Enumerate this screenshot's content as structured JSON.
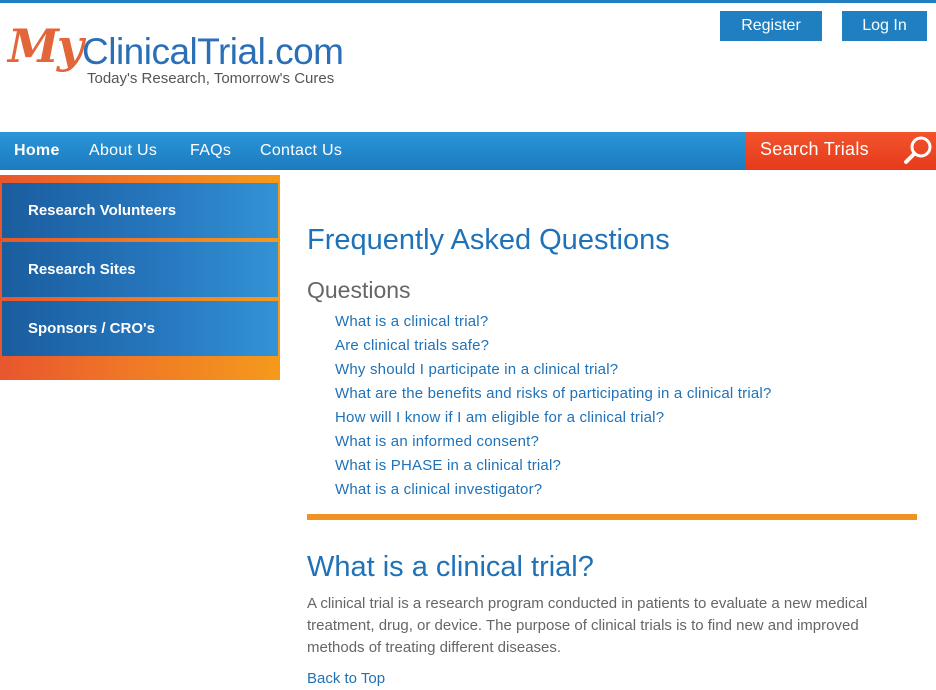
{
  "logo": {
    "my": "My",
    "name": "ClinicalTrial.com",
    "tagline": "Today's Research, Tomorrow's Cures"
  },
  "header": {
    "register_label": "Register",
    "login_label": "Log In"
  },
  "nav": {
    "home": "Home",
    "about": "About  Us",
    "faqs": "FAQs",
    "contact": "Contact  Us",
    "search_label": "Search Trials"
  },
  "sidebar": {
    "items": [
      {
        "label": "Research Volunteers"
      },
      {
        "label": "Research Sites"
      },
      {
        "label": "Sponsors  /  CRO's"
      }
    ]
  },
  "main": {
    "title": "Frequently Asked Questions",
    "questions_heading": "Questions",
    "questions": [
      "What is a clinical trial?",
      "Are clinical trials safe?",
      "Why should I participate in a clinical trial?",
      "What are the benefits and risks of participating in a clinical trial?",
      "How will I know if I am eligible for a clinical trial?",
      "What is an informed consent?",
      "What is PHASE in a clinical trial?",
      "What is a clinical investigator?"
    ],
    "answer_title": "What is a clinical trial?",
    "answer_body": "A clinical trial is a research program conducted in patients to evaluate a new medical treatment, drug, or device. The purpose of clinical trials is to find new and improved methods of treating different diseases.",
    "back_to_top": "Back to Top"
  },
  "colors": {
    "brand_blue": "#1f7fc0",
    "link_blue": "#1f72b8",
    "accent_orange": "#f39224",
    "search_red": "#e63a1c"
  }
}
